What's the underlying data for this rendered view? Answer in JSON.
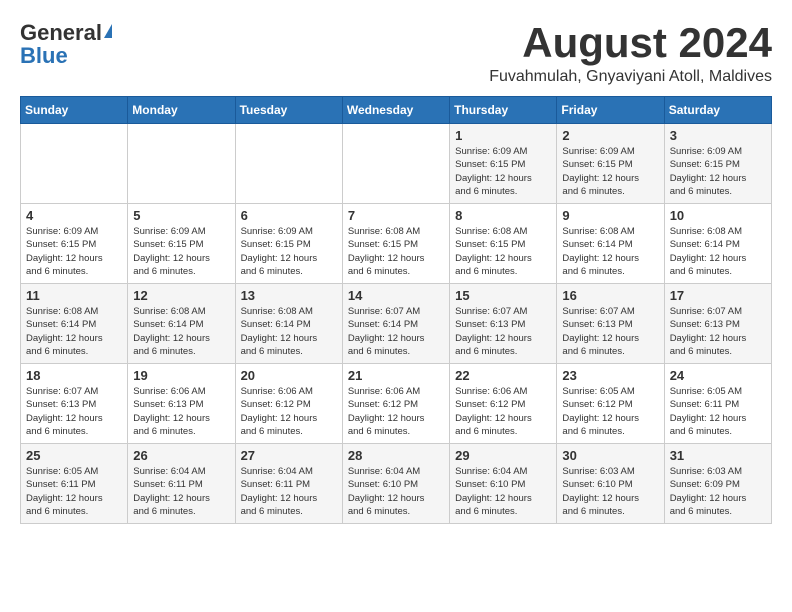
{
  "header": {
    "logo_general": "General",
    "logo_blue": "Blue",
    "month_title": "August 2024",
    "location": "Fuvahmulah, Gnyaviyani Atoll, Maldives"
  },
  "weekdays": [
    "Sunday",
    "Monday",
    "Tuesday",
    "Wednesday",
    "Thursday",
    "Friday",
    "Saturday"
  ],
  "weeks": [
    [
      {
        "day": "",
        "content": ""
      },
      {
        "day": "",
        "content": ""
      },
      {
        "day": "",
        "content": ""
      },
      {
        "day": "",
        "content": ""
      },
      {
        "day": "1",
        "content": "Sunrise: 6:09 AM\nSunset: 6:15 PM\nDaylight: 12 hours\nand 6 minutes."
      },
      {
        "day": "2",
        "content": "Sunrise: 6:09 AM\nSunset: 6:15 PM\nDaylight: 12 hours\nand 6 minutes."
      },
      {
        "day": "3",
        "content": "Sunrise: 6:09 AM\nSunset: 6:15 PM\nDaylight: 12 hours\nand 6 minutes."
      }
    ],
    [
      {
        "day": "4",
        "content": "Sunrise: 6:09 AM\nSunset: 6:15 PM\nDaylight: 12 hours\nand 6 minutes."
      },
      {
        "day": "5",
        "content": "Sunrise: 6:09 AM\nSunset: 6:15 PM\nDaylight: 12 hours\nand 6 minutes."
      },
      {
        "day": "6",
        "content": "Sunrise: 6:09 AM\nSunset: 6:15 PM\nDaylight: 12 hours\nand 6 minutes."
      },
      {
        "day": "7",
        "content": "Sunrise: 6:08 AM\nSunset: 6:15 PM\nDaylight: 12 hours\nand 6 minutes."
      },
      {
        "day": "8",
        "content": "Sunrise: 6:08 AM\nSunset: 6:15 PM\nDaylight: 12 hours\nand 6 minutes."
      },
      {
        "day": "9",
        "content": "Sunrise: 6:08 AM\nSunset: 6:14 PM\nDaylight: 12 hours\nand 6 minutes."
      },
      {
        "day": "10",
        "content": "Sunrise: 6:08 AM\nSunset: 6:14 PM\nDaylight: 12 hours\nand 6 minutes."
      }
    ],
    [
      {
        "day": "11",
        "content": "Sunrise: 6:08 AM\nSunset: 6:14 PM\nDaylight: 12 hours\nand 6 minutes."
      },
      {
        "day": "12",
        "content": "Sunrise: 6:08 AM\nSunset: 6:14 PM\nDaylight: 12 hours\nand 6 minutes."
      },
      {
        "day": "13",
        "content": "Sunrise: 6:08 AM\nSunset: 6:14 PM\nDaylight: 12 hours\nand 6 minutes."
      },
      {
        "day": "14",
        "content": "Sunrise: 6:07 AM\nSunset: 6:14 PM\nDaylight: 12 hours\nand 6 minutes."
      },
      {
        "day": "15",
        "content": "Sunrise: 6:07 AM\nSunset: 6:13 PM\nDaylight: 12 hours\nand 6 minutes."
      },
      {
        "day": "16",
        "content": "Sunrise: 6:07 AM\nSunset: 6:13 PM\nDaylight: 12 hours\nand 6 minutes."
      },
      {
        "day": "17",
        "content": "Sunrise: 6:07 AM\nSunset: 6:13 PM\nDaylight: 12 hours\nand 6 minutes."
      }
    ],
    [
      {
        "day": "18",
        "content": "Sunrise: 6:07 AM\nSunset: 6:13 PM\nDaylight: 12 hours\nand 6 minutes."
      },
      {
        "day": "19",
        "content": "Sunrise: 6:06 AM\nSunset: 6:13 PM\nDaylight: 12 hours\nand 6 minutes."
      },
      {
        "day": "20",
        "content": "Sunrise: 6:06 AM\nSunset: 6:12 PM\nDaylight: 12 hours\nand 6 minutes."
      },
      {
        "day": "21",
        "content": "Sunrise: 6:06 AM\nSunset: 6:12 PM\nDaylight: 12 hours\nand 6 minutes."
      },
      {
        "day": "22",
        "content": "Sunrise: 6:06 AM\nSunset: 6:12 PM\nDaylight: 12 hours\nand 6 minutes."
      },
      {
        "day": "23",
        "content": "Sunrise: 6:05 AM\nSunset: 6:12 PM\nDaylight: 12 hours\nand 6 minutes."
      },
      {
        "day": "24",
        "content": "Sunrise: 6:05 AM\nSunset: 6:11 PM\nDaylight: 12 hours\nand 6 minutes."
      }
    ],
    [
      {
        "day": "25",
        "content": "Sunrise: 6:05 AM\nSunset: 6:11 PM\nDaylight: 12 hours\nand 6 minutes."
      },
      {
        "day": "26",
        "content": "Sunrise: 6:04 AM\nSunset: 6:11 PM\nDaylight: 12 hours\nand 6 minutes."
      },
      {
        "day": "27",
        "content": "Sunrise: 6:04 AM\nSunset: 6:11 PM\nDaylight: 12 hours\nand 6 minutes."
      },
      {
        "day": "28",
        "content": "Sunrise: 6:04 AM\nSunset: 6:10 PM\nDaylight: 12 hours\nand 6 minutes."
      },
      {
        "day": "29",
        "content": "Sunrise: 6:04 AM\nSunset: 6:10 PM\nDaylight: 12 hours\nand 6 minutes."
      },
      {
        "day": "30",
        "content": "Sunrise: 6:03 AM\nSunset: 6:10 PM\nDaylight: 12 hours\nand 6 minutes."
      },
      {
        "day": "31",
        "content": "Sunrise: 6:03 AM\nSunset: 6:09 PM\nDaylight: 12 hours\nand 6 minutes."
      }
    ]
  ]
}
